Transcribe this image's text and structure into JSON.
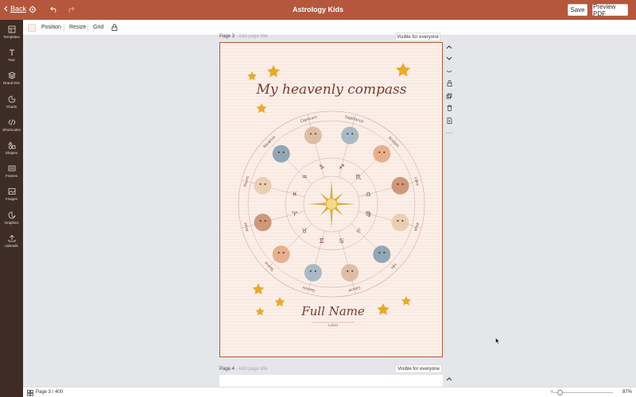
{
  "header": {
    "back_label": "Back",
    "title": "Astrology Kids",
    "save_label": "Save",
    "preview_label": "Preview PDF"
  },
  "toolbar": {
    "position_label": "Position",
    "resize_label": "Resize",
    "grid_label": "Grid"
  },
  "sidebar": {
    "items": [
      {
        "label": "Templates",
        "icon": "templates-icon"
      },
      {
        "label": "Text",
        "icon": "text-icon"
      },
      {
        "label": "Brand Kits",
        "icon": "brand-kits-icon"
      },
      {
        "label": "Charts",
        "icon": "charts-icon"
      },
      {
        "label": "Shortcodes",
        "icon": "shortcodes-icon"
      },
      {
        "label": "Shapes",
        "icon": "shapes-icon"
      },
      {
        "label": "Frames",
        "icon": "frames-icon"
      },
      {
        "label": "Images",
        "icon": "images-icon"
      },
      {
        "label": "Graphics",
        "icon": "graphics-icon"
      },
      {
        "label": "Uploads",
        "icon": "uploads-icon"
      }
    ]
  },
  "canvas": {
    "page3": {
      "label": "Page 3",
      "title_placeholder": "- Add page title",
      "visibility": "Visible for everyone"
    },
    "page4": {
      "label": "Page 4",
      "title_placeholder": "- Add page title",
      "visibility": "Visible for everyone"
    }
  },
  "design": {
    "heading": "My heavenly compass",
    "name_text": "Full Name",
    "label_text": "Label",
    "signs": [
      "Capricorn",
      "Sagittarius",
      "Scorpio",
      "Libra",
      "Virgo",
      "Leo",
      "Cancer",
      "Gemini",
      "Taurus",
      "Aries",
      "Pisces",
      "Aquarius"
    ],
    "glyphs": [
      "♑",
      "♐",
      "♏",
      "♎",
      "♍",
      "♌",
      "♋",
      "♊",
      "♉",
      "♈",
      "♓",
      "♒"
    ],
    "colors": {
      "brand": "#b4573d",
      "page_bg": "#fbefe8",
      "ink": "#7a3b2e",
      "star": "#e7a92e",
      "sun": "#d9a52a"
    }
  },
  "footer": {
    "page_info": "Page 3 / 400",
    "zoom": "87%"
  }
}
